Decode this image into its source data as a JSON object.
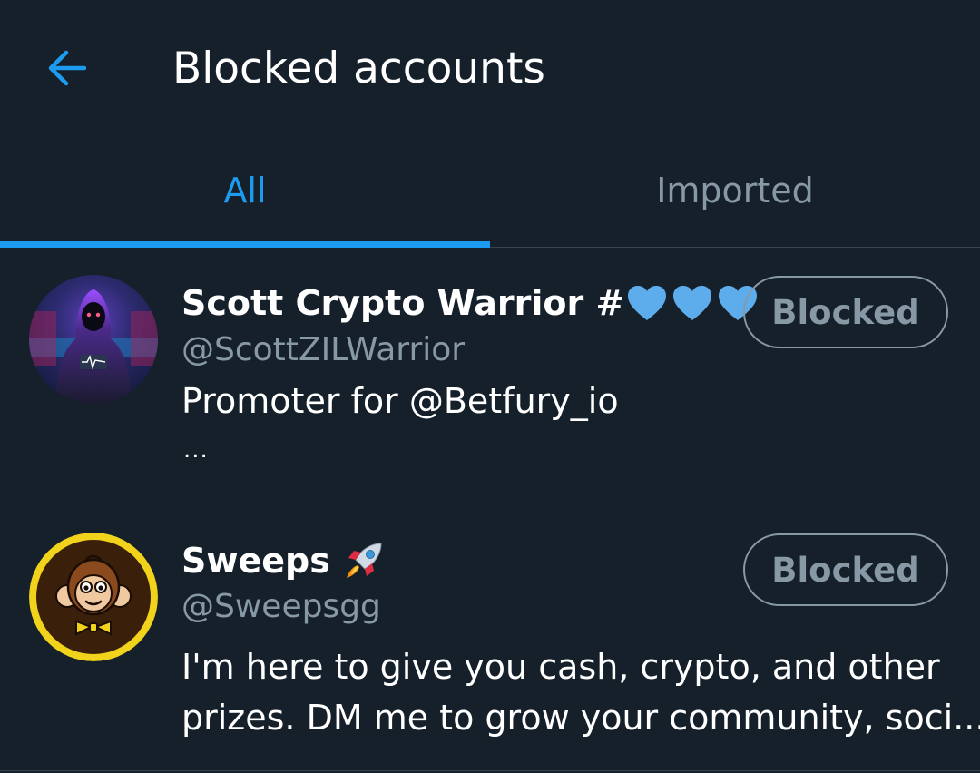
{
  "header": {
    "back_icon": "arrow-left-icon",
    "title": "Blocked accounts"
  },
  "tabs": [
    {
      "label": "All",
      "active": true
    },
    {
      "label": "Imported",
      "active": false
    }
  ],
  "colors": {
    "background": "#15202b",
    "accent": "#1d9bf0",
    "muted": "#8899a6",
    "divider": "#38444d"
  },
  "accounts": [
    {
      "name": "Scott Crypto Warrior #",
      "name_icons": [
        "blue-heart-icon",
        "blue-heart-icon",
        "blue-heart-icon"
      ],
      "handle": "@ScottZILWarrior",
      "bio_line1": "Promoter for @Betfury_io",
      "bio_more": "...",
      "button_label": "Blocked",
      "avatar_icon": "hooded-figure-avatar"
    },
    {
      "name": "Sweeps",
      "name_icons": [
        "rocket-icon"
      ],
      "handle": "@Sweepsgg",
      "bio_line1": "I'm here to give you cash, crypto, and other",
      "bio_line2": "prizes. DM me to grow your community, soci...",
      "button_label": "Blocked",
      "avatar_icon": "monkey-avatar"
    }
  ]
}
